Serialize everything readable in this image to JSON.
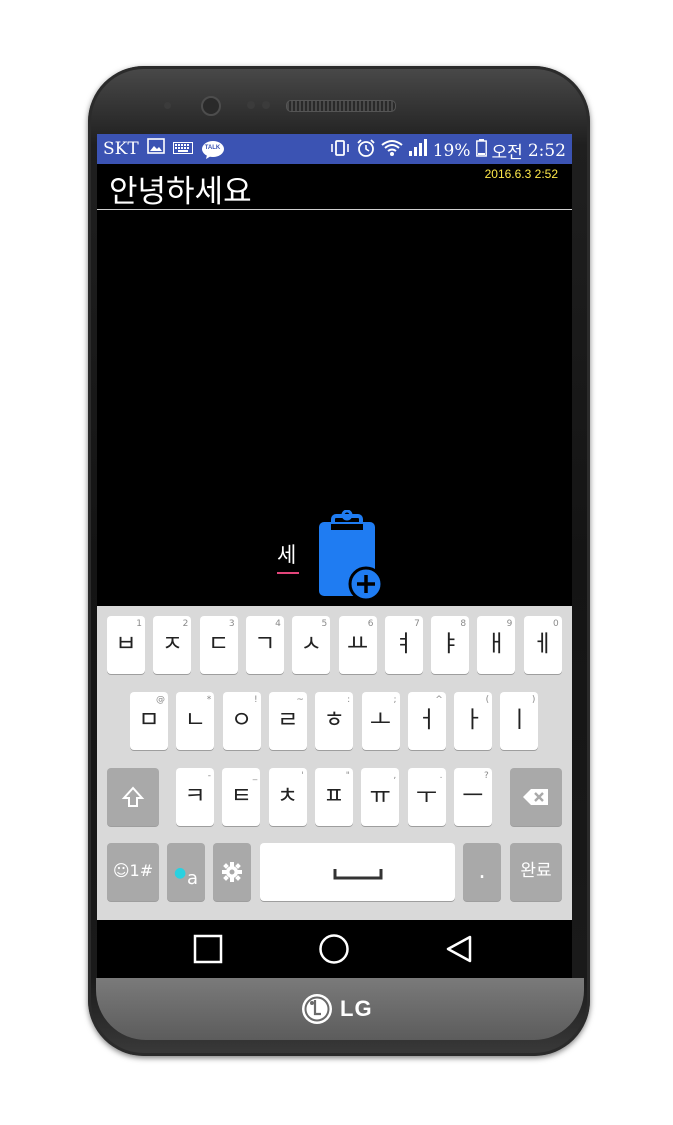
{
  "status_bar": {
    "carrier": "SKT",
    "battery_percent": "19%",
    "ampm": "오전",
    "time": "2:52",
    "icons_left": [
      "gallery-icon",
      "keyboard-icon",
      "kakaotalk-icon"
    ],
    "icons_right": [
      "vibrate-icon",
      "alarm-icon",
      "wifi-icon",
      "signal-icon",
      "battery-icon"
    ],
    "talk_label": "TALK"
  },
  "message": {
    "title": "안녕하세요",
    "date": "2016.6.3 2:52"
  },
  "composing": {
    "text": "세"
  },
  "keyboard": {
    "row1": [
      {
        "label": "ㅂ",
        "hint": "1"
      },
      {
        "label": "ㅈ",
        "hint": "2"
      },
      {
        "label": "ㄷ",
        "hint": "3"
      },
      {
        "label": "ㄱ",
        "hint": "4"
      },
      {
        "label": "ㅅ",
        "hint": "5"
      },
      {
        "label": "ㅛ",
        "hint": "6"
      },
      {
        "label": "ㅕ",
        "hint": "7"
      },
      {
        "label": "ㅑ",
        "hint": "8"
      },
      {
        "label": "ㅐ",
        "hint": "9"
      },
      {
        "label": "ㅔ",
        "hint": "0"
      }
    ],
    "row2": [
      {
        "label": "ㅁ",
        "hint": "@"
      },
      {
        "label": "ㄴ",
        "hint": "*"
      },
      {
        "label": "ㅇ",
        "hint": "!"
      },
      {
        "label": "ㄹ",
        "hint": "~"
      },
      {
        "label": "ㅎ",
        "hint": ":"
      },
      {
        "label": "ㅗ",
        "hint": ";"
      },
      {
        "label": "ㅓ",
        "hint": "^"
      },
      {
        "label": "ㅏ",
        "hint": "("
      },
      {
        "label": "ㅣ",
        "hint": ")"
      }
    ],
    "row3": [
      {
        "label": "ㅋ",
        "hint": "-"
      },
      {
        "label": "ㅌ",
        "hint": "_"
      },
      {
        "label": "ㅊ",
        "hint": "'"
      },
      {
        "label": "ㅍ",
        "hint": "\""
      },
      {
        "label": "ㅠ",
        "hint": ","
      },
      {
        "label": "ㅜ",
        "hint": "."
      },
      {
        "label": "ㅡ",
        "hint": "?"
      }
    ],
    "symbols_label": "☺1#",
    "lang_label": "a",
    "period_label": ".",
    "done_label": "완료"
  },
  "brand": {
    "logo_text": "LG"
  },
  "colors": {
    "status_bar": "#3b53b3",
    "date_text": "#ffe94a",
    "clipboard": "#1f7cf2",
    "composing_underline": "#e2457a"
  }
}
